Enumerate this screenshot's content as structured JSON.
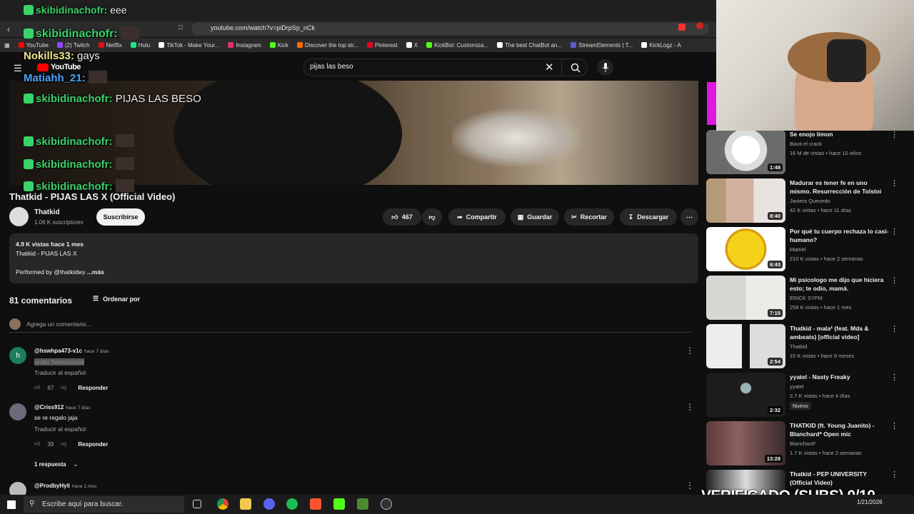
{
  "browser": {
    "url": "youtube.com/watch?v=piDrpSp_nCk",
    "bookmarks": [
      "YouTube",
      "(2) Twitch",
      "Netflix",
      "Hulu",
      "TikTok - Make Your...",
      "Instagram",
      "Kick",
      "Discover the top str...",
      "Pinterest",
      "X",
      "KickBot: Customiza...",
      "The best ChatBot an...",
      "StreamElements | T...",
      "KickLogz - A"
    ],
    "bookmark_colors": [
      "#ff0000",
      "#9146ff",
      "#e50914",
      "#1ce783",
      "#ffffff",
      "#e1306c",
      "#53fc18",
      "#ff6a00",
      "#e60023",
      "#ffffff",
      "#53fc18",
      "#ffffff",
      "#5b5bd6",
      "#ffffff"
    ]
  },
  "youtube": {
    "logo_text": "YouTube",
    "search_value": "pijas las beso",
    "video_title": "Thatkid - PIJAS LAS X (Official Video)",
    "channel_name": "Thatkid",
    "subscribers": "1.06 K suscriptores",
    "subscribe_label": "Suscribirse",
    "likes": "467",
    "share_label": "Compartir",
    "save_label": "Guardar",
    "clip_label": "Recortar",
    "download_label": "Descargar",
    "desc_stats": "4.9 K vistas  hace 1 mes",
    "desc_line": "Thatkid - PIJAS LAS X",
    "desc_performed": "Performed by @thatkidwy",
    "desc_more": "...más",
    "comment_count": "81 comentarios",
    "sort_label": "Ordenar por",
    "add_comment": "Agrega un comentario..."
  },
  "comments": [
    {
      "user": "@hswhpa473-v1c",
      "time": "hace 7 días",
      "text": "under homosexual",
      "translate": "Traducir al español",
      "likes": "67",
      "reply": "Responder"
    },
    {
      "user": "@Criss912",
      "time": "hace 7 días",
      "text": "se re regalo jaja",
      "translate": "Traducir al español",
      "likes": "39",
      "reply": "Responder",
      "replies": "1 respuesta"
    },
    {
      "user": "@ProdbyHyli",
      "time": "hace 1 mes"
    }
  ],
  "chat": [
    {
      "user": "skibidinachofr:",
      "msg": "eee"
    },
    {
      "user": "skibidinachofr:",
      "msg": ""
    },
    {
      "user": "Nokills33:",
      "msg": "gays"
    },
    {
      "user": "Matiahh_21:",
      "msg": ""
    },
    {
      "user": "skibidinachofr:",
      "msg": "PIJAS LAS BESO"
    },
    {
      "user": "skibidinachofr:",
      "msg": ""
    },
    {
      "user": "skibidinachofr:",
      "msg": ""
    },
    {
      "user": "skibidinachofr:",
      "msg": ""
    }
  ],
  "recommendations": [
    {
      "title": "Se enojo limon",
      "channel": "Bauti el crack",
      "meta": "16 M de vistas • hace 10 años",
      "duration": "1:48"
    },
    {
      "title": "Madurar es tener fe en uno mismo. Resurrección de Tolstoi",
      "channel": "Javiera Quevedo",
      "meta": "42 K vistas • hace 11 días",
      "duration": "8:40"
    },
    {
      "title": "Por qué tu cuerpo rechaza lo casi-humano?",
      "channel": "Matriel",
      "meta": "210 K vistas • hace 2 semanas",
      "duration": "6:43"
    },
    {
      "title": "Mi psicologo me dijo que hiciera esto; te odio, mamá.",
      "channel": "ERICK SYFM",
      "meta": "258 K vistas • hace 1 mes",
      "duration": "7:15"
    },
    {
      "title": "Thatkid - mala² (feat. Mda & ambeats) [official video]",
      "channel": "Thatkid",
      "meta": "15 K vistas • hace 9 meses",
      "duration": "2:54"
    },
    {
      "title": "yyatel - Nasty Freaky",
      "channel": "yyatel",
      "meta": "2.7 K vistas • hace 4 días",
      "duration": "2:32",
      "badge": "Nuevo"
    },
    {
      "title": "THATKID (ft. Young Juanito) - Blanchard* Open mic",
      "channel": "Blanchard*",
      "meta": "1.7 K vistas • hace 2 semanas",
      "duration": "13:28"
    },
    {
      "title": "Thatkid - PEP UNIVERSITY (Official Video)",
      "channel": "",
      "meta": "",
      "duration": ""
    }
  ],
  "overlay": {
    "verified": "VERIFICADO (SUBS) 0/10"
  },
  "taskbar": {
    "search_placeholder": "Escribe aquí para buscar.",
    "date": "1/21/2026"
  }
}
